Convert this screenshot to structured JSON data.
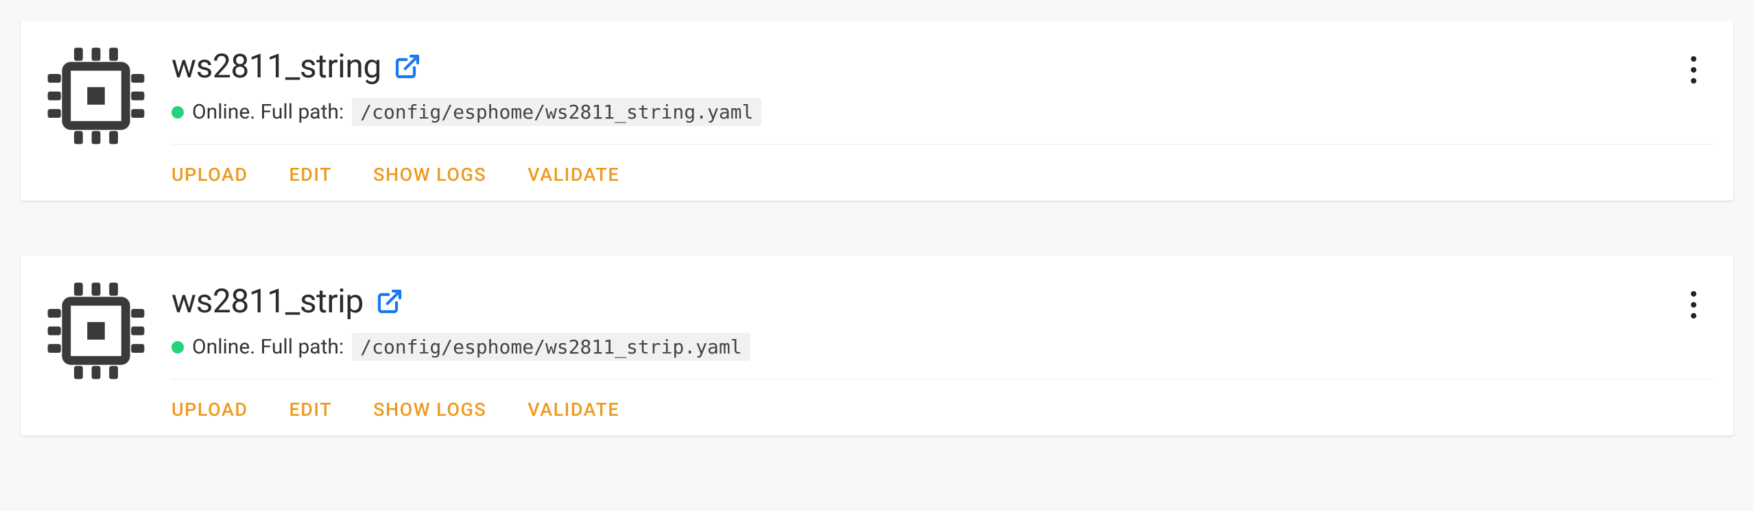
{
  "status_label_prefix": "Online. Full path:",
  "actions": {
    "upload": "UPLOAD",
    "edit": "EDIT",
    "show_logs": "SHOW LOGS",
    "validate": "VALIDATE"
  },
  "devices": [
    {
      "name": "ws2811_string",
      "online": true,
      "path": "/config/esphome/ws2811_string.yaml"
    },
    {
      "name": "ws2811_strip",
      "online": true,
      "path": "/config/esphome/ws2811_strip.yaml"
    }
  ],
  "colors": {
    "accent": "#ee9a1f",
    "link": "#1877f2",
    "online_dot": "#25d47a"
  }
}
